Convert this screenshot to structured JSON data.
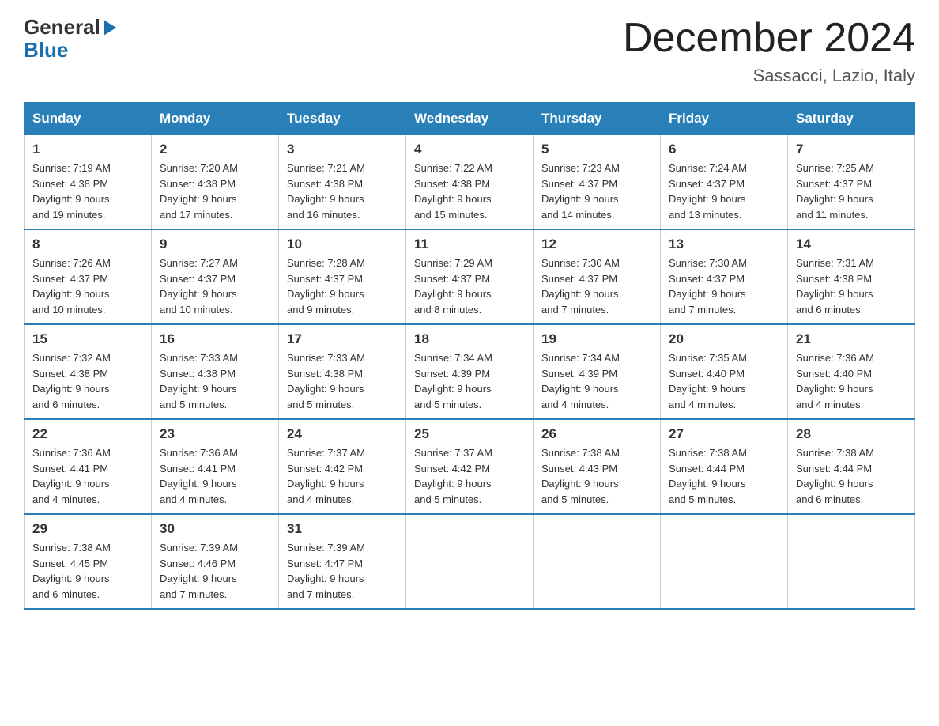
{
  "header": {
    "logo_line1": "General",
    "logo_line2": "Blue",
    "title": "December 2024",
    "subtitle": "Sassacci, Lazio, Italy"
  },
  "days_of_week": [
    "Sunday",
    "Monday",
    "Tuesday",
    "Wednesday",
    "Thursday",
    "Friday",
    "Saturday"
  ],
  "weeks": [
    [
      {
        "day": "1",
        "sunrise": "7:19 AM",
        "sunset": "4:38 PM",
        "daylight": "9 hours and 19 minutes."
      },
      {
        "day": "2",
        "sunrise": "7:20 AM",
        "sunset": "4:38 PM",
        "daylight": "9 hours and 17 minutes."
      },
      {
        "day": "3",
        "sunrise": "7:21 AM",
        "sunset": "4:38 PM",
        "daylight": "9 hours and 16 minutes."
      },
      {
        "day": "4",
        "sunrise": "7:22 AM",
        "sunset": "4:38 PM",
        "daylight": "9 hours and 15 minutes."
      },
      {
        "day": "5",
        "sunrise": "7:23 AM",
        "sunset": "4:37 PM",
        "daylight": "9 hours and 14 minutes."
      },
      {
        "day": "6",
        "sunrise": "7:24 AM",
        "sunset": "4:37 PM",
        "daylight": "9 hours and 13 minutes."
      },
      {
        "day": "7",
        "sunrise": "7:25 AM",
        "sunset": "4:37 PM",
        "daylight": "9 hours and 11 minutes."
      }
    ],
    [
      {
        "day": "8",
        "sunrise": "7:26 AM",
        "sunset": "4:37 PM",
        "daylight": "9 hours and 10 minutes."
      },
      {
        "day": "9",
        "sunrise": "7:27 AM",
        "sunset": "4:37 PM",
        "daylight": "9 hours and 10 minutes."
      },
      {
        "day": "10",
        "sunrise": "7:28 AM",
        "sunset": "4:37 PM",
        "daylight": "9 hours and 9 minutes."
      },
      {
        "day": "11",
        "sunrise": "7:29 AM",
        "sunset": "4:37 PM",
        "daylight": "9 hours and 8 minutes."
      },
      {
        "day": "12",
        "sunrise": "7:30 AM",
        "sunset": "4:37 PM",
        "daylight": "9 hours and 7 minutes."
      },
      {
        "day": "13",
        "sunrise": "7:30 AM",
        "sunset": "4:37 PM",
        "daylight": "9 hours and 7 minutes."
      },
      {
        "day": "14",
        "sunrise": "7:31 AM",
        "sunset": "4:38 PM",
        "daylight": "9 hours and 6 minutes."
      }
    ],
    [
      {
        "day": "15",
        "sunrise": "7:32 AM",
        "sunset": "4:38 PM",
        "daylight": "9 hours and 6 minutes."
      },
      {
        "day": "16",
        "sunrise": "7:33 AM",
        "sunset": "4:38 PM",
        "daylight": "9 hours and 5 minutes."
      },
      {
        "day": "17",
        "sunrise": "7:33 AM",
        "sunset": "4:38 PM",
        "daylight": "9 hours and 5 minutes."
      },
      {
        "day": "18",
        "sunrise": "7:34 AM",
        "sunset": "4:39 PM",
        "daylight": "9 hours and 5 minutes."
      },
      {
        "day": "19",
        "sunrise": "7:34 AM",
        "sunset": "4:39 PM",
        "daylight": "9 hours and 4 minutes."
      },
      {
        "day": "20",
        "sunrise": "7:35 AM",
        "sunset": "4:40 PM",
        "daylight": "9 hours and 4 minutes."
      },
      {
        "day": "21",
        "sunrise": "7:36 AM",
        "sunset": "4:40 PM",
        "daylight": "9 hours and 4 minutes."
      }
    ],
    [
      {
        "day": "22",
        "sunrise": "7:36 AM",
        "sunset": "4:41 PM",
        "daylight": "9 hours and 4 minutes."
      },
      {
        "day": "23",
        "sunrise": "7:36 AM",
        "sunset": "4:41 PM",
        "daylight": "9 hours and 4 minutes."
      },
      {
        "day": "24",
        "sunrise": "7:37 AM",
        "sunset": "4:42 PM",
        "daylight": "9 hours and 4 minutes."
      },
      {
        "day": "25",
        "sunrise": "7:37 AM",
        "sunset": "4:42 PM",
        "daylight": "9 hours and 5 minutes."
      },
      {
        "day": "26",
        "sunrise": "7:38 AM",
        "sunset": "4:43 PM",
        "daylight": "9 hours and 5 minutes."
      },
      {
        "day": "27",
        "sunrise": "7:38 AM",
        "sunset": "4:44 PM",
        "daylight": "9 hours and 5 minutes."
      },
      {
        "day": "28",
        "sunrise": "7:38 AM",
        "sunset": "4:44 PM",
        "daylight": "9 hours and 6 minutes."
      }
    ],
    [
      {
        "day": "29",
        "sunrise": "7:38 AM",
        "sunset": "4:45 PM",
        "daylight": "9 hours and 6 minutes."
      },
      {
        "day": "30",
        "sunrise": "7:39 AM",
        "sunset": "4:46 PM",
        "daylight": "9 hours and 7 minutes."
      },
      {
        "day": "31",
        "sunrise": "7:39 AM",
        "sunset": "4:47 PM",
        "daylight": "9 hours and 7 minutes."
      },
      null,
      null,
      null,
      null
    ]
  ],
  "labels": {
    "sunrise": "Sunrise:",
    "sunset": "Sunset:",
    "daylight": "Daylight:"
  }
}
